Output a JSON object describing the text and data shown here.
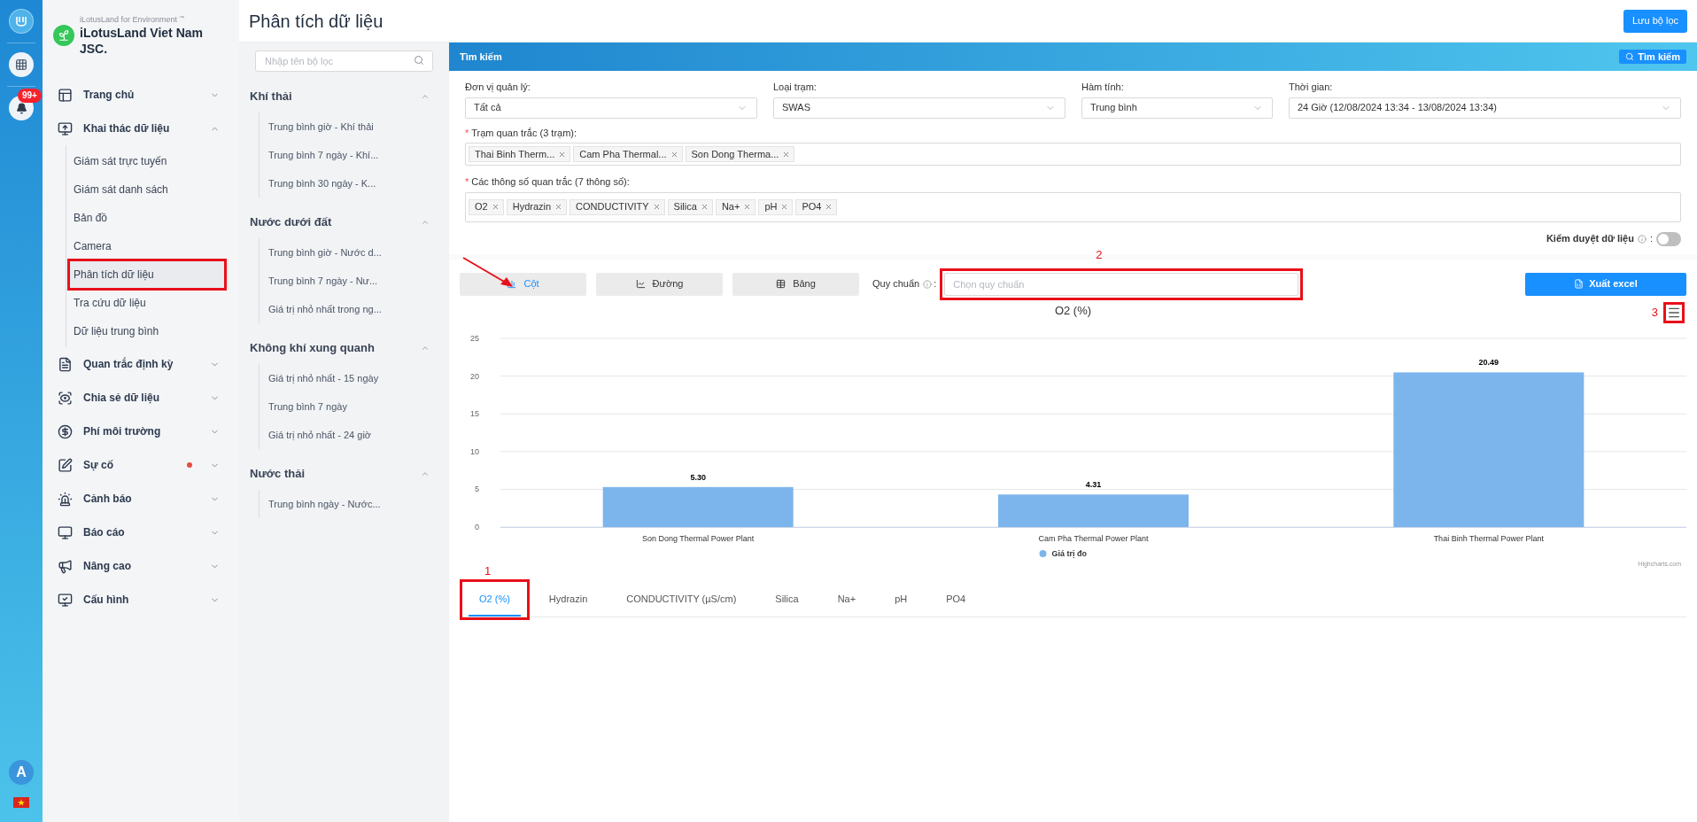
{
  "rail": {
    "badge": "99+",
    "avatar": "A"
  },
  "brand": {
    "tagline": "iLotusLand for Environment",
    "tm": "™",
    "name": "iLotusLand Viet Nam JSC."
  },
  "nav": [
    {
      "label": "Trang chủ",
      "expanded": false,
      "dot": false
    },
    {
      "label": "Khai thác dữ liệu",
      "expanded": true,
      "dot": false,
      "children": [
        {
          "label": "Giám sát trực tuyến",
          "selected": false
        },
        {
          "label": "Giám sát danh sách",
          "selected": false
        },
        {
          "label": "Bản đồ",
          "selected": false
        },
        {
          "label": "Camera",
          "selected": false
        },
        {
          "label": "Phân tích dữ liệu",
          "selected": true
        },
        {
          "label": "Tra cứu dữ liệu",
          "selected": false
        },
        {
          "label": "Dữ liệu trung bình",
          "selected": false
        }
      ]
    },
    {
      "label": "Quan trắc định kỳ",
      "expanded": false,
      "dot": false
    },
    {
      "label": "Chia sẻ dữ liệu",
      "expanded": false,
      "dot": false
    },
    {
      "label": "Phí môi trường",
      "expanded": false,
      "dot": false
    },
    {
      "label": "Sự cố",
      "expanded": false,
      "dot": true
    },
    {
      "label": "Cảnh báo",
      "expanded": false,
      "dot": false
    },
    {
      "label": "Báo cáo",
      "expanded": false,
      "dot": false
    },
    {
      "label": "Nâng cao",
      "expanded": false,
      "dot": false
    },
    {
      "label": "Cấu hình",
      "expanded": false,
      "dot": false
    }
  ],
  "header": {
    "title": "Phân tích dữ liệu",
    "save_button": "Lưu bộ lọc"
  },
  "filters": {
    "placeholder": "Nhập tên bộ lọc",
    "groups": [
      {
        "title": "Khí thải",
        "expanded": true,
        "items": [
          "Trung bình giờ - Khí thải",
          "Trung bình 7 ngày - Khí...",
          "Trung bình 30 ngày - K..."
        ]
      },
      {
        "title": "Nước dưới đất",
        "expanded": true,
        "items": [
          "Trung bình giờ - Nước d...",
          "Trung bình 7 ngày - Nư...",
          "Giá trị nhỏ nhất trong ng..."
        ]
      },
      {
        "title": "Không khí xung quanh",
        "expanded": true,
        "items": [
          "Giá trị nhỏ nhất - 15 ngày",
          "Trung bình 7 ngày",
          "Giá trị nhỏ nhất - 24 giờ"
        ]
      },
      {
        "title": "Nước thải",
        "expanded": true,
        "items": [
          "Trung bình ngày - Nước..."
        ]
      }
    ]
  },
  "search_panel": {
    "title": "Tìm kiếm",
    "button": "Tìm kiếm"
  },
  "fields": [
    {
      "label": "Đơn vị quản lý:",
      "value": "Tất cả"
    },
    {
      "label": "Loại trạm:",
      "value": "SWAS"
    },
    {
      "label": "Hàm tính:",
      "value": "Trung bình"
    },
    {
      "label": "Thời gian:",
      "value": "24 Giờ (12/08/2024 13:34 - 13/08/2024 13:34)"
    }
  ],
  "stations": {
    "required_mark": "*",
    "label": "Trạm quan trắc (3 trạm):",
    "tags": [
      "Thai Binh Therm...",
      "Cam Pha Thermal...",
      "Son Dong Therma..."
    ]
  },
  "params": {
    "required_mark": "*",
    "label": "Các thông số quan trắc (7 thông số):",
    "tags": [
      "O2",
      "Hydrazin",
      "CONDUCTIVITY",
      "Silica",
      "Na+",
      "pH",
      "PO4"
    ]
  },
  "approval": {
    "label": "Kiểm duyệt dữ liệu",
    "colon": ":",
    "on": false
  },
  "view_buttons": [
    {
      "label": "Cột",
      "selected": true
    },
    {
      "label": "Đường",
      "selected": false
    },
    {
      "label": "Bảng",
      "selected": false
    }
  ],
  "standard": {
    "label": "Quy chuẩn",
    "colon": ":",
    "placeholder": "Chọn quy chuẩn"
  },
  "export_button": "Xuất excel",
  "chart": {
    "credit": "Highcharts.com",
    "chart_data": {
      "type": "bar",
      "title": "O2 (%)",
      "categories": [
        "Son Dong Thermal Power Plant",
        "Cam Pha Thermal Power Plant",
        "Thai Binh Thermal Power Plant"
      ],
      "series": [
        {
          "name": "Giá trị đo",
          "color": "#7cb5ec",
          "values": [
            5.3,
            4.31,
            20.49
          ]
        }
      ],
      "ylim": [
        0,
        25
      ],
      "grid": true,
      "yticks": [
        0,
        5,
        10,
        15,
        20,
        25
      ],
      "value_labels": [
        "5.30",
        "4.31",
        "20.49"
      ]
    }
  },
  "tabs": [
    {
      "label": "O2 (%)",
      "selected": true
    },
    {
      "label": "Hydrazin",
      "selected": false
    },
    {
      "label": "CONDUCTIVITY (µS/cm)",
      "selected": false
    },
    {
      "label": "Silica",
      "selected": false
    },
    {
      "label": "Na+",
      "selected": false
    },
    {
      "label": "pH",
      "selected": false
    },
    {
      "label": "PO4",
      "selected": false
    }
  ],
  "annotations": {
    "tabs": "1",
    "standard": "2",
    "menu": "3"
  }
}
